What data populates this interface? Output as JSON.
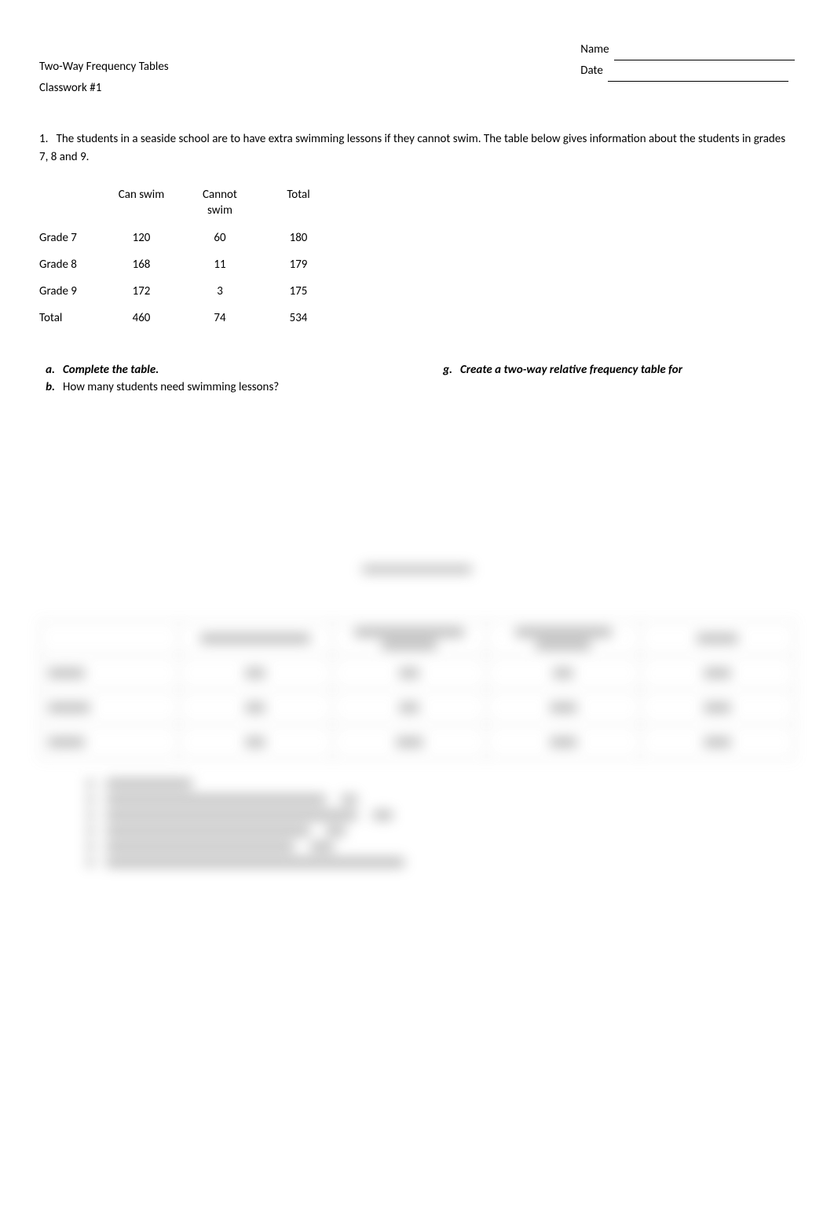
{
  "header": {
    "name_label": "Name",
    "date_label": "Date",
    "title": "Two-Way Frequency Tables",
    "subtitle": "Classwork #1"
  },
  "question1": {
    "number": "1.",
    "text": "The students in a seaside school are to have extra swimming lessons if they cannot swim. The table below gives information about the students in grades 7, 8 and 9."
  },
  "table": {
    "headers": [
      "",
      "Can swim",
      "Cannot swim",
      "Total"
    ],
    "rows": [
      {
        "label": "Grade 7",
        "can_swim": "120",
        "cannot_swim": "60",
        "total": "180"
      },
      {
        "label": "Grade 8",
        "can_swim": "168",
        "cannot_swim": "11",
        "total": "179"
      },
      {
        "label": "Grade 9",
        "can_swim": "172",
        "cannot_swim": "3",
        "total": "175"
      },
      {
        "label": "Total",
        "can_swim": "460",
        "cannot_swim": "74",
        "total": "534"
      }
    ]
  },
  "sub_questions": {
    "left": [
      {
        "letter": "a.",
        "text": "Complete the table.",
        "bold": true
      },
      {
        "letter": "b.",
        "text": "How many students need swimming lessons?",
        "bold": false
      }
    ],
    "right": [
      {
        "letter": "g.",
        "text": "Create a two-way relative frequency table for",
        "bold": true
      }
    ]
  }
}
